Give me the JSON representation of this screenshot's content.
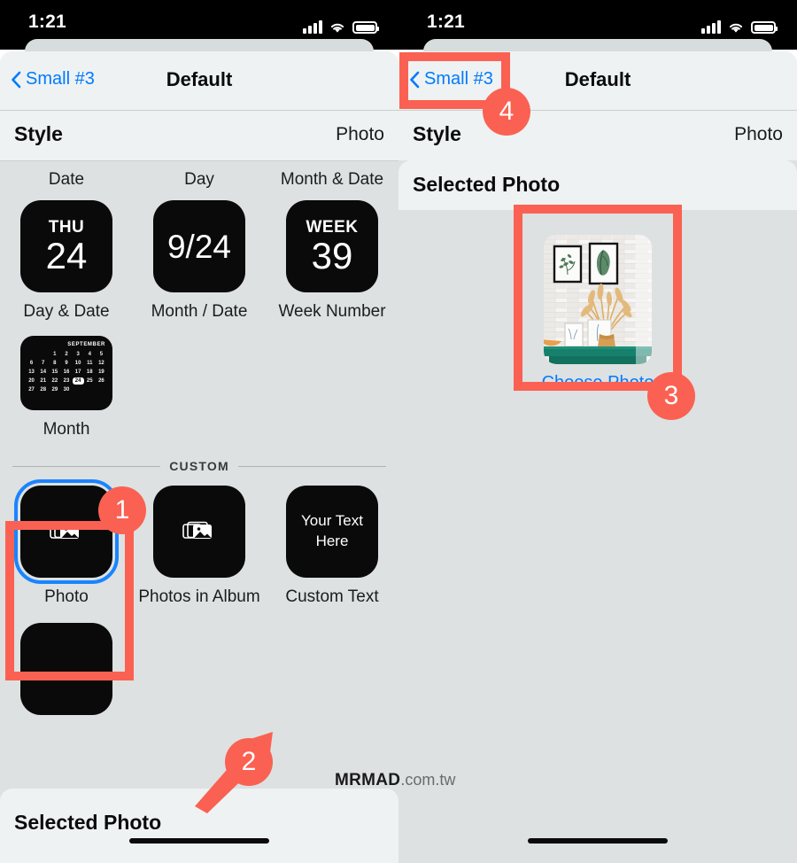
{
  "status_bar": {
    "time": "1:21",
    "icons": [
      "signal-bars",
      "wifi",
      "battery"
    ]
  },
  "left_phone": {
    "nav": {
      "back_label": "Small #3",
      "title": "Default"
    },
    "style_row": {
      "label": "Style",
      "value": "Photo"
    },
    "widget_groups": [
      {
        "header": "Date",
        "tile_line1": "THU",
        "tile_line2": "24",
        "label": "Day & Date"
      },
      {
        "header": "Day",
        "tile_line1": "",
        "tile_line2": "9/24",
        "label": "Month / Date"
      },
      {
        "header": "Month & Date",
        "tile_line1": "WEEK",
        "tile_line2": "39",
        "label": "Week Number"
      }
    ],
    "month_widget": {
      "label": "Month",
      "month_name": "SEPTEMBER",
      "leading_blanks": 2,
      "days": [
        1,
        2,
        3,
        4,
        5,
        6,
        7,
        8,
        9,
        10,
        11,
        12,
        13,
        14,
        15,
        16,
        17,
        18,
        19,
        20,
        21,
        22,
        23,
        24,
        25,
        26,
        27,
        28,
        29,
        30
      ],
      "today": 24
    },
    "custom_section": {
      "header": "CUSTOM",
      "items": [
        {
          "label": "Photo",
          "icon": "photos-stack-icon",
          "selected": true,
          "text": ""
        },
        {
          "label": "Photos in Album",
          "icon": "photos-stack-icon",
          "selected": false,
          "text": ""
        },
        {
          "label": "Custom Text",
          "icon": "",
          "selected": false,
          "text": "Your Text Here"
        }
      ]
    },
    "bottom_sheet": {
      "label": "Selected Photo"
    }
  },
  "right_phone": {
    "nav": {
      "back_label": "Small #3",
      "title": "Default"
    },
    "style_row": {
      "label": "Style",
      "value": "Photo"
    },
    "selected_photo_sheet": {
      "label": "Selected Photo"
    },
    "photo_picker": {
      "choose_label": "Choose Photo",
      "thumbnail_alt": "room-with-framed-prints-and-vase-photo"
    }
  },
  "annotations": {
    "steps": [
      {
        "number": "1",
        "target": "photo-style-tile"
      },
      {
        "number": "2",
        "target": "selected-photo-sheet"
      },
      {
        "number": "3",
        "target": "choose-photo-thumbnail"
      },
      {
        "number": "4",
        "target": "back-to-small-3"
      }
    ],
    "accent_color": "#fa6152",
    "selection_color": "#1a84ff"
  },
  "watermark": {
    "bold": "MRMAD",
    "rest": ".com.tw"
  }
}
